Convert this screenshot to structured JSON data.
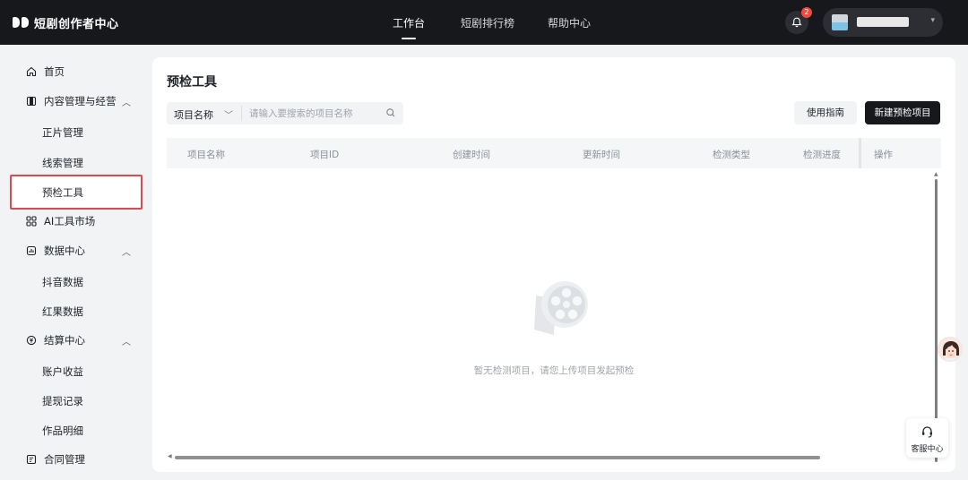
{
  "app": {
    "logo_text": "短剧创作者中心"
  },
  "topnav": {
    "items": [
      {
        "label": "工作台",
        "active": true
      },
      {
        "label": "短剧排行榜",
        "active": false
      },
      {
        "label": "帮助中心",
        "active": false
      }
    ],
    "notification_count": "2"
  },
  "sidebar": {
    "home": "首页",
    "content_group": "内容管理与经营",
    "content_items": [
      "正片管理",
      "线索管理",
      "预检工具"
    ],
    "ai_market": "AI工具市场",
    "data_group": "数据中心",
    "data_items": [
      "抖音数据",
      "红果数据"
    ],
    "settlement_group": "结算中心",
    "settlement_items": [
      "账户收益",
      "提现记录",
      "作品明细"
    ],
    "contract": "合同管理",
    "active_item": "预检工具"
  },
  "main": {
    "title": "预检工具",
    "search": {
      "select_value": "项目名称",
      "placeholder": "请输入要搜索的项目名称"
    },
    "guide_button": "使用指南",
    "new_button": "新建预检项目",
    "table": {
      "columns": [
        "项目名称",
        "项目ID",
        "创建时间",
        "更新时间",
        "检测类型",
        "检测进度",
        "操作"
      ],
      "rows": []
    },
    "empty_text": "暂无检测项目，请您上传项目发起预检"
  },
  "floating": {
    "service_label": "客服中心"
  },
  "colors": {
    "topbar": "#17181c",
    "highlight_border": "#e0484f",
    "badge": "#f04a3e",
    "primary_button": "#17181c"
  }
}
